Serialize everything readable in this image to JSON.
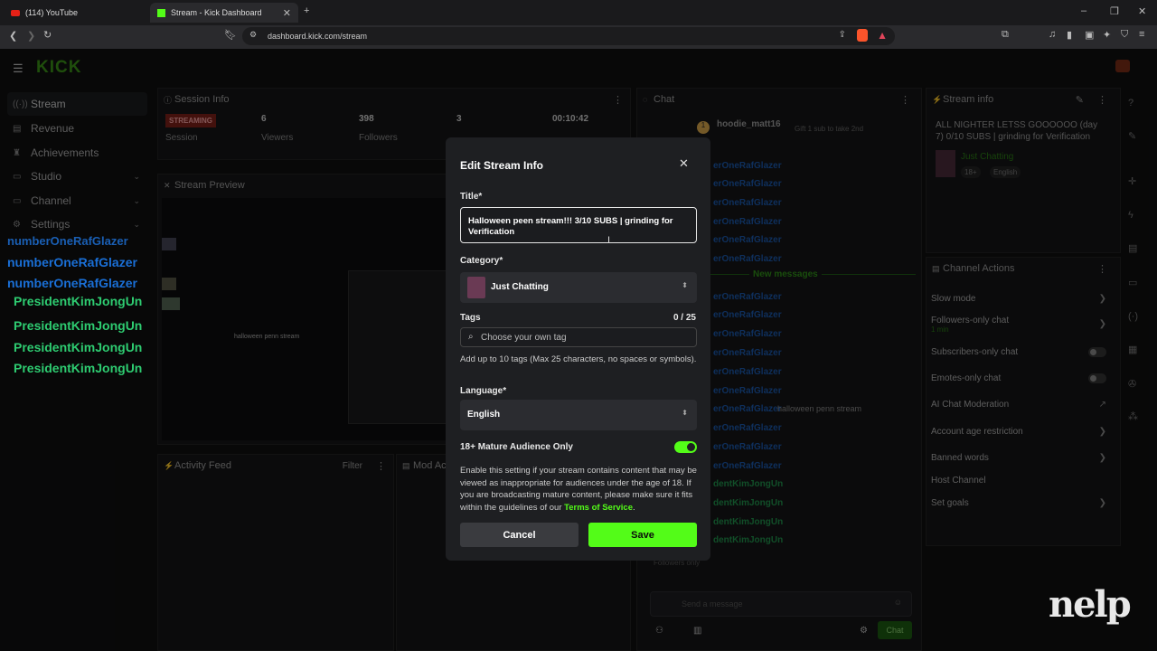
{
  "browser": {
    "tabs": [
      {
        "title": "(114) YouTube"
      },
      {
        "title": "Stream - Kick Dashboard"
      }
    ],
    "url": "dashboard.kick.com/stream"
  },
  "app": {
    "logo": "KICK",
    "sidebar": {
      "items": [
        {
          "label": "Stream",
          "icon": "broadcast-icon"
        },
        {
          "label": "Revenue",
          "icon": "dollar-icon"
        },
        {
          "label": "Achievements",
          "icon": "trophy-icon"
        },
        {
          "label": "Studio",
          "icon": "studio-icon"
        },
        {
          "label": "Channel",
          "icon": "channel-icon"
        },
        {
          "label": "Settings",
          "icon": "gear-icon"
        }
      ]
    },
    "overlay_names": [
      "numberOneRafGlazer",
      "numberOneRafGlazer",
      "numberOneRafGlazer",
      "PresidentKimJongUn",
      "PresidentKimJongUn",
      "PresidentKimJongUn",
      "PresidentKimJongUn"
    ],
    "session": {
      "title": "Session Info",
      "status": "STREAMING",
      "status_label": "Session",
      "viewers_value": "6",
      "viewers_label": "Viewers",
      "followers_value": "398",
      "followers_label": "Followers",
      "third_value": "3",
      "time_value": "00:10:42"
    },
    "preview": {
      "title": "Stream Preview",
      "overlay_text": "halloween penn stream"
    },
    "activity": {
      "title": "Activity Feed",
      "filter": "Filter"
    },
    "mod": {
      "title": "Mod Ac"
    },
    "chat": {
      "title": "Chat",
      "pinned_user": "hoodie_matt16",
      "pinned_note": "Gift 1 sub to take 2nd",
      "new_messages": "New messages",
      "truncated_names": [
        "erOneRafGlazer",
        "dentKimJongUn"
      ],
      "last_message": "halloween penn stream",
      "followers_only": "Followers only",
      "input_placeholder": "Send a message",
      "send_button": "Chat"
    },
    "stream_info": {
      "title": "Stream info",
      "stream_title": "ALL NIGHTER LETSS GOOOOOO (day 7) 0/10 SUBS | grinding for Verification",
      "category": "Just Chatting",
      "tag_age": "18+",
      "tag_language": "English"
    },
    "channel_actions": {
      "title": "Channel Actions",
      "items": [
        {
          "label": "Slow mode",
          "control": "chevron"
        },
        {
          "label": "Followers-only chat",
          "sub": "1 min",
          "control": "chevron"
        },
        {
          "label": "Subscribers-only chat",
          "control": "toggle"
        },
        {
          "label": "Emotes-only chat",
          "control": "toggle"
        },
        {
          "label": "AI Chat Moderation",
          "control": "external"
        },
        {
          "label": "Account age restriction",
          "control": "chevron"
        },
        {
          "label": "Banned words",
          "control": "chevron"
        },
        {
          "label": "Host Channel",
          "control": "none"
        },
        {
          "label": "Set goals",
          "control": "chevron"
        }
      ]
    }
  },
  "modal": {
    "title": "Edit Stream Info",
    "title_label": "Title*",
    "title_value": "Halloween peen stream!!!  3/10 SUBS   | grinding for Verification",
    "category_label": "Category*",
    "category_value": "Just Chatting",
    "tags_label": "Tags",
    "tags_count": "0 / 25",
    "tags_placeholder": "Choose your own tag",
    "tags_help": "Add up to 10 tags (Max 25 characters, no spaces or symbols).",
    "language_label": "Language*",
    "language_value": "English",
    "mature_label": "18+ Mature Audience Only",
    "mature_enabled": true,
    "mature_help": "Enable this setting if your stream contains content that may be viewed as inappropriate for audiences under the age of 18. If you are broadcasting mature content, please make sure it fits within the guidelines of our",
    "tos_link": "Terms of Service",
    "tos_suffix": ".",
    "cancel_label": "Cancel",
    "save_label": "Save"
  },
  "watermark": "nelp",
  "colors": {
    "accent": "#53fc18",
    "streaming": "#c0392b",
    "overlay_blue": "#1a6fd6",
    "overlay_green": "#2ecc71"
  }
}
